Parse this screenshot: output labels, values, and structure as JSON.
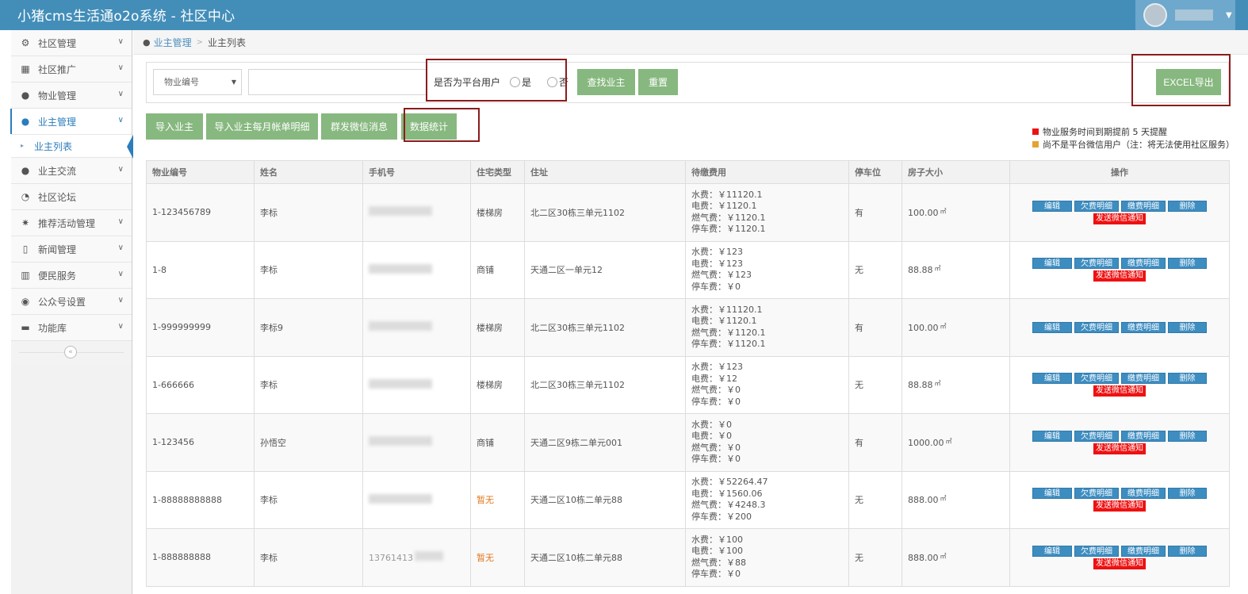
{
  "app": {
    "title": "小猪cms生活通o2o系统 - 社区中心"
  },
  "sidebar": {
    "items": [
      {
        "label": "社区管理"
      },
      {
        "label": "社区推广"
      },
      {
        "label": "物业管理"
      },
      {
        "label": "业主管理",
        "active": true,
        "sub": [
          {
            "label": "业主列表"
          }
        ]
      },
      {
        "label": "业主交流"
      },
      {
        "label": "社区论坛"
      },
      {
        "label": "推荐活动管理"
      },
      {
        "label": "新闻管理"
      },
      {
        "label": "便民服务"
      },
      {
        "label": "公众号设置"
      },
      {
        "label": "功能库"
      }
    ],
    "collapse_icon": "«"
  },
  "breadcrumb": {
    "parent": "业主管理",
    "current": "业主列表"
  },
  "filter": {
    "select_value": "物业编号",
    "radio_label": "是否为平台用户",
    "option_yes": "是",
    "option_no": "否",
    "search_btn": "查找业主",
    "reset_btn": "重置",
    "excel_btn": "EXCEL导出"
  },
  "actions": {
    "import_owner": "导入业主",
    "import_monthly": "导入业主每月帐单明细",
    "mass_wechat": "群发微信消息",
    "data_stats": "数据统计"
  },
  "legend": {
    "red_text": "物业服务时间到期提前 5 天提醒",
    "orange_text": "尚不是平台微信用户（注：将无法使用社区服务）",
    "red_color": "#ee1111",
    "orange_color": "#e4a431"
  },
  "table": {
    "headers": [
      "物业编号",
      "姓名",
      "手机号",
      "住宅类型",
      "住址",
      "待缴费用",
      "停车位",
      "房子大小",
      "操作"
    ],
    "op_labels": {
      "edit": "编辑",
      "arrears": "欠费明细",
      "paid": "缴费明细",
      "delete": "删除",
      "notify": "发送微信通知"
    },
    "rows": [
      {
        "code": "1-123456789",
        "name": "李标",
        "phone": "",
        "type": "楼梯房",
        "address": "北二区30栋三单元1102",
        "fees": [
          "水费：￥11120.1",
          "电费：￥1120.1",
          "燃气费：￥1120.1",
          "停车费：￥1120.1"
        ],
        "parking": "有",
        "size": "100.00",
        "notify": true
      },
      {
        "code": "1-8",
        "name": "李标",
        "phone": "",
        "type": "商铺",
        "address": "天通二区一单元12",
        "fees": [
          "水费：￥123",
          "电费：￥123",
          "燃气费：￥123",
          "停车费：￥0"
        ],
        "parking": "无",
        "size": "88.88",
        "notify": true
      },
      {
        "code": "1-999999999",
        "name": "李标9",
        "phone": "",
        "type": "楼梯房",
        "address": "北二区30栋三单元1102",
        "fees": [
          "水费：￥11120.1",
          "电费：￥1120.1",
          "燃气费：￥1120.1",
          "停车费：￥1120.1"
        ],
        "parking": "有",
        "size": "100.00",
        "notify": false
      },
      {
        "code": "1-666666",
        "name": "李标",
        "phone": "",
        "type": "楼梯房",
        "address": "北二区30栋三单元1102",
        "fees": [
          "水费：￥123",
          "电费：￥12",
          "燃气费：￥0",
          "停车费：￥0"
        ],
        "parking": "无",
        "size": "88.88",
        "notify": true
      },
      {
        "code": "1-123456",
        "name": "孙悟空",
        "phone": "",
        "type": "商铺",
        "address": "天通二区9栋二单元001",
        "fees": [
          "水费：￥0",
          "电费：￥0",
          "燃气费：￥0",
          "停车费：￥0"
        ],
        "parking": "有",
        "size": "1000.00",
        "notify": true
      },
      {
        "code": "1-88888888888",
        "name": "李标",
        "phone": "",
        "type": "暂无",
        "address": "天通二区10栋二单元88",
        "fees": [
          "水费：￥52264.47",
          "电费：￥1560.06",
          "燃气费：￥4248.3",
          "停车费：￥200"
        ],
        "parking": "无",
        "size": "888.00",
        "notify": true
      },
      {
        "code": "1-888888888",
        "name": "李标",
        "phone": "13761413",
        "type": "暂无",
        "address": "天通二区10栋二单元88",
        "fees": [
          "水费：￥100",
          "电费：￥100",
          "燃气费：￥88",
          "停车费：￥0"
        ],
        "parking": "无",
        "size": "888.00",
        "notify": true
      }
    ],
    "unit": "㎡"
  }
}
